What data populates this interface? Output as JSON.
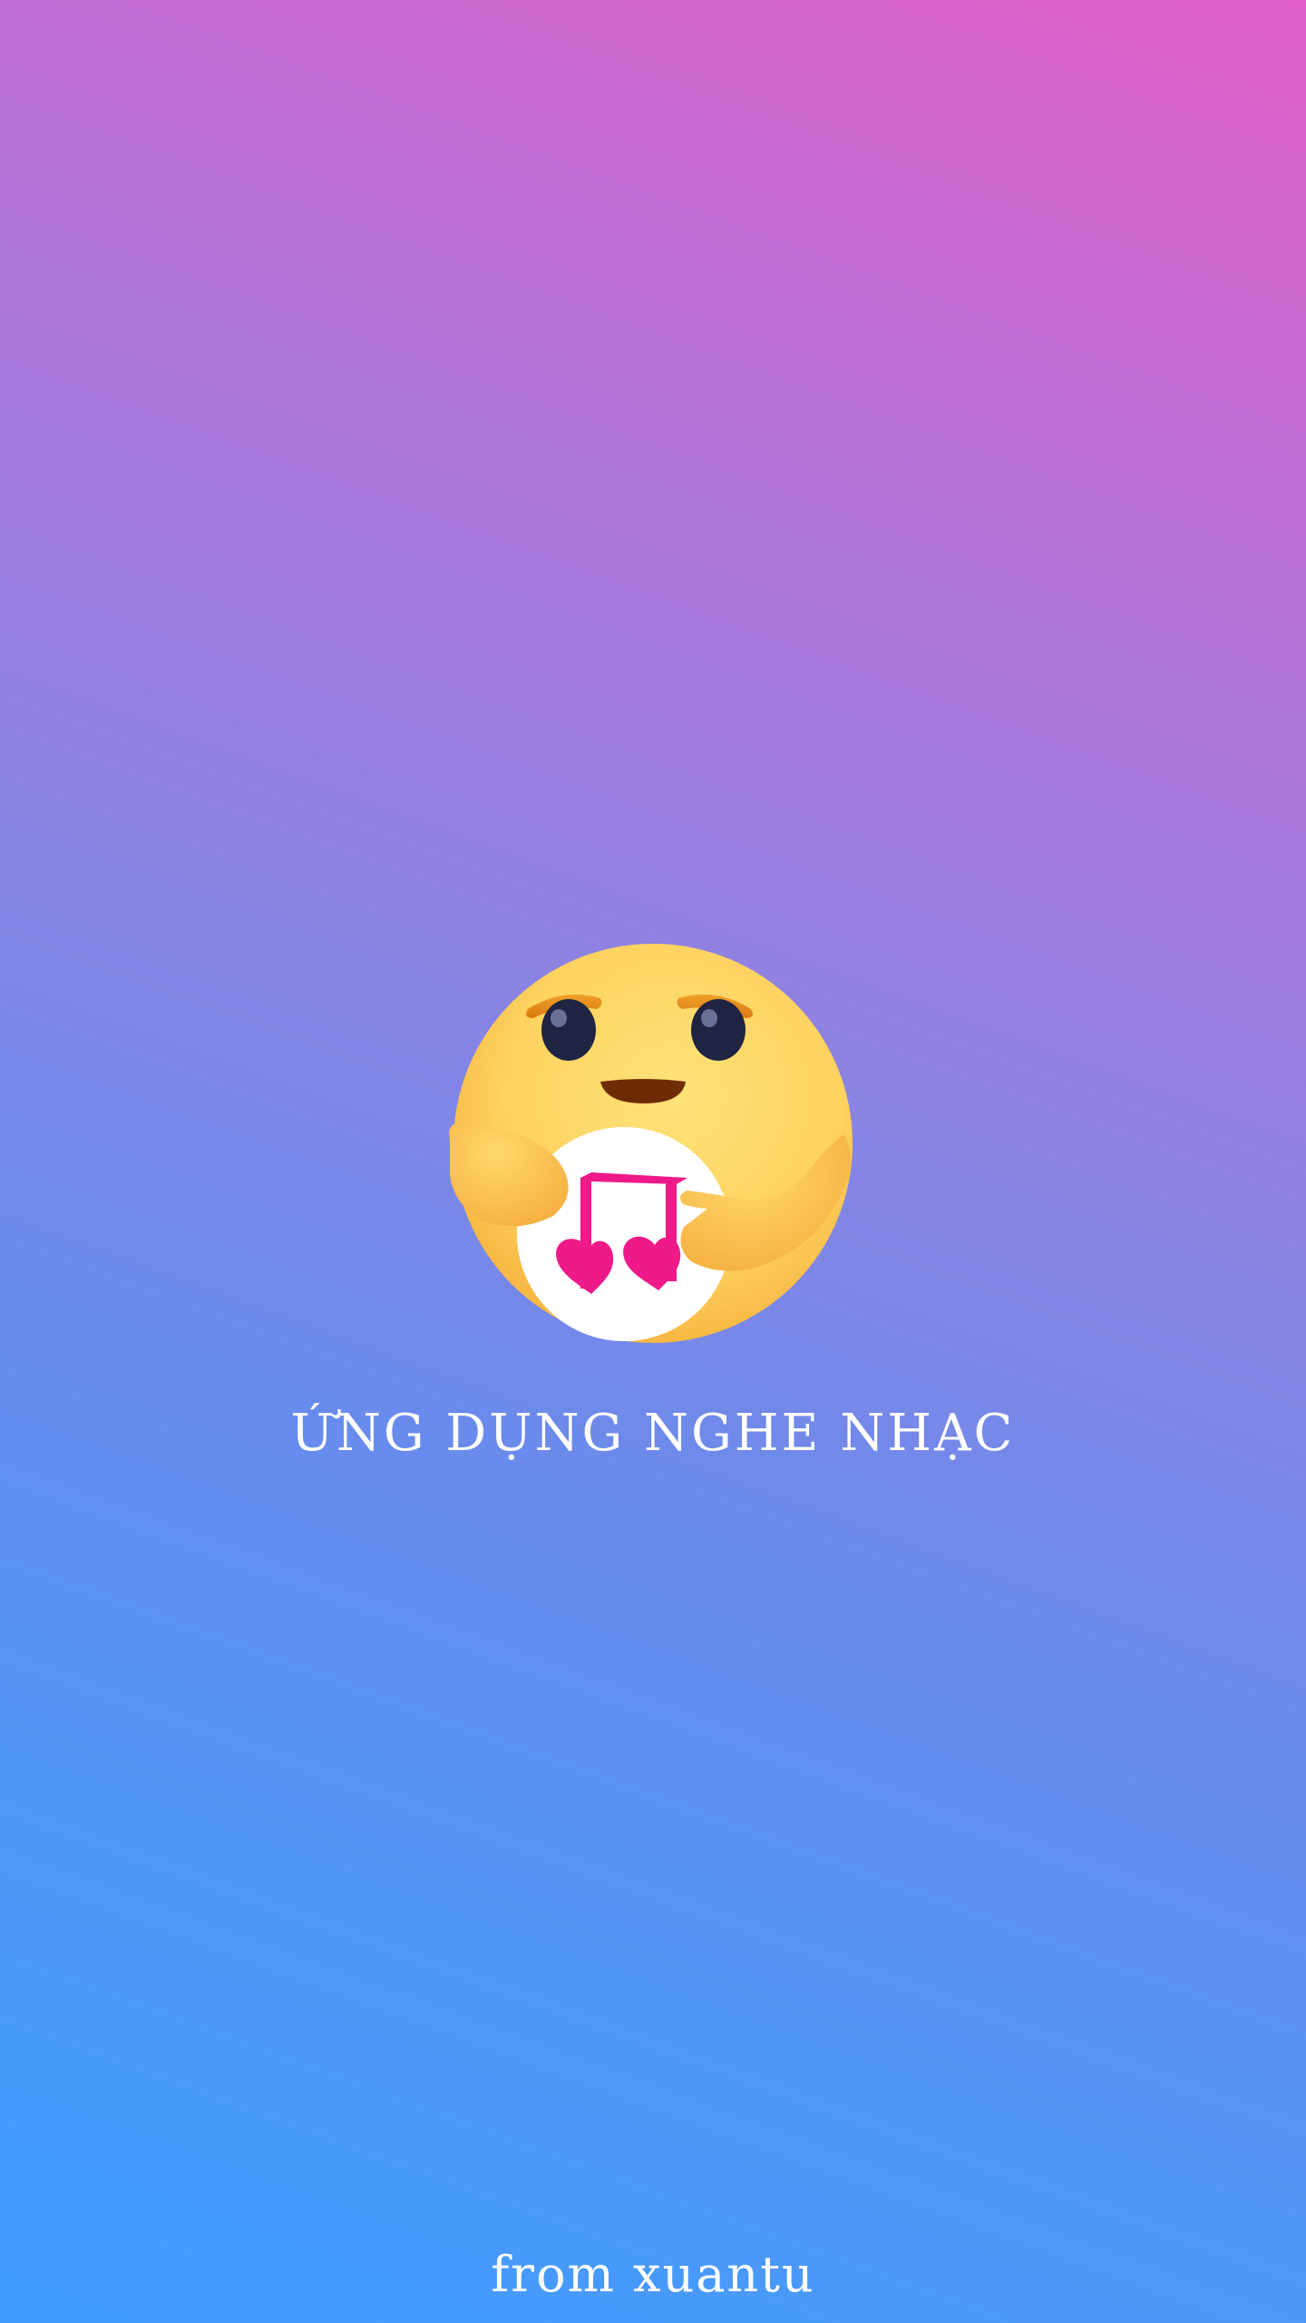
{
  "screen": {
    "name": "splash-screen",
    "background_gradient": [
      "#e05fc6",
      "#b673d8",
      "#8b83e2",
      "#6a8bec",
      "#4f97f6",
      "#3f9dff"
    ]
  },
  "logo": {
    "icon": "care-emoji-hugging-music-note-icon",
    "colors": {
      "face": "#fdd25f",
      "face_shade": "#f7b13d",
      "brow": "#e8911c",
      "eye": "#1f2442",
      "mouth": "#6e2c05",
      "disc": "#ffffff",
      "note": "#ee1a8a"
    }
  },
  "app_title": "ỨNG DỤNG NGHE NHẠC",
  "footer": {
    "credit": "from xuantu"
  }
}
